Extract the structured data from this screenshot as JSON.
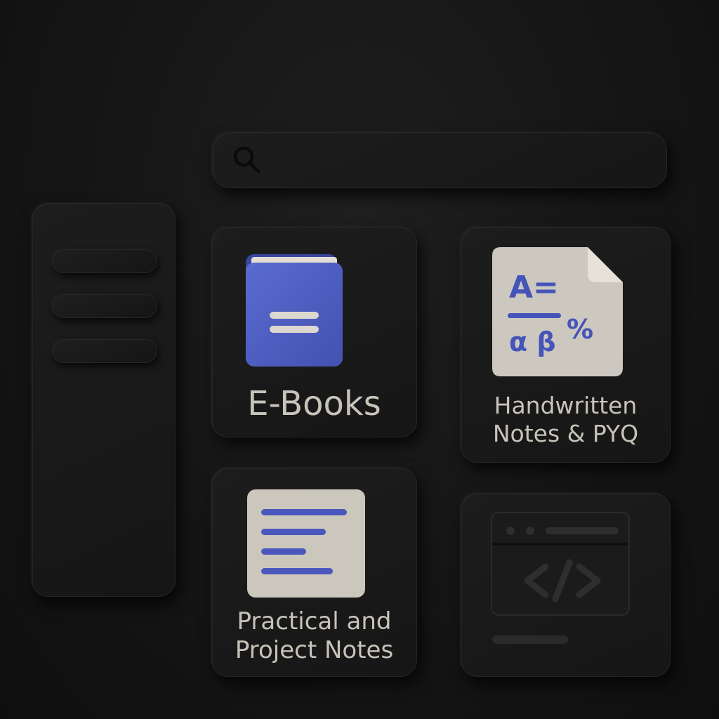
{
  "search": {
    "placeholder": "",
    "icon": "search-icon"
  },
  "sidebar": {
    "items": [
      {
        "label": ""
      },
      {
        "label": ""
      },
      {
        "label": ""
      }
    ]
  },
  "cards": {
    "ebooks": {
      "label": "E-Books",
      "icon": "book-icon"
    },
    "handwritten": {
      "label_line1": "Handwritten",
      "label_line2": "Notes & PYQ",
      "icon": "formula-document-icon",
      "icon_text_1": "A=",
      "icon_text_2": "α β",
      "icon_text_3": "%"
    },
    "practical": {
      "label_line1": "Practical and",
      "label_line2": "Project Notes",
      "icon": "notes-document-icon"
    },
    "code": {
      "icon": "code-window-icon"
    }
  },
  "colors": {
    "background": "#141414",
    "card": "#1a1a1a",
    "text": "#c8c3ba",
    "accent_blue": "#4f5fc0",
    "paper": "#ccc7bd"
  }
}
